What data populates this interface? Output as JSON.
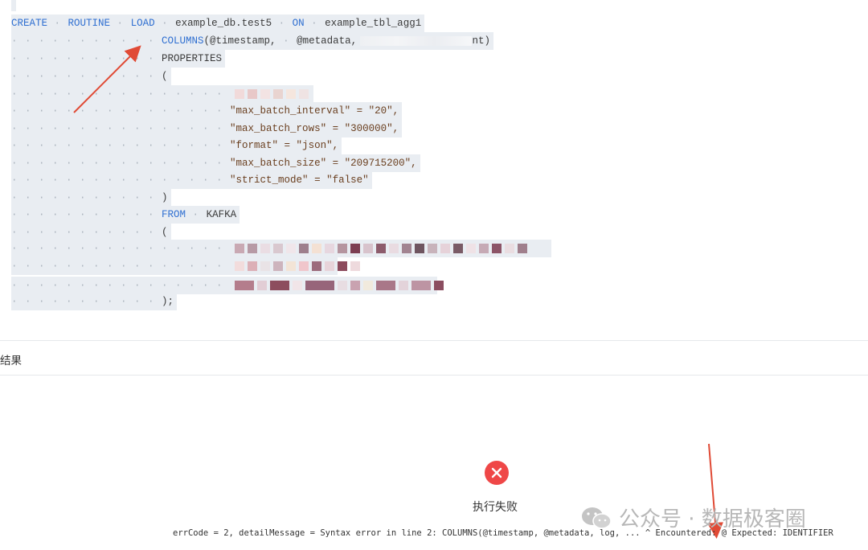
{
  "code": {
    "l1": {
      "kw1": "CREATE",
      "kw2": "ROUTINE",
      "kw3": "LOAD",
      "t1": "example_db.test5",
      "kw4": "ON",
      "t2": "example_tbl_agg1"
    },
    "l2": {
      "kw": "COLUMNS",
      "t1": "(@timestamp,",
      "t2": "@metadata,",
      "t3": "nt)"
    },
    "l3": {
      "kw": "PROPERTIES"
    },
    "l4": {
      "t": "("
    },
    "l6": {
      "t": "\"max_batch_interval\" = \"20\","
    },
    "l7": {
      "t": "\"max_batch_rows\" = \"300000\","
    },
    "l8": {
      "t": "\"format\" = \"json\","
    },
    "l9": {
      "t": "\"max_batch_size\" = \"209715200\","
    },
    "l10": {
      "t": "\"strict_mode\" = \"false\""
    },
    "l11": {
      "t": ")"
    },
    "l12": {
      "kw": "FROM",
      "t": "KAFKA"
    },
    "l13": {
      "t": "("
    },
    "l17": {
      "t": ");"
    }
  },
  "result": {
    "tab_label": "结果",
    "status_title": "执行失败",
    "error_message": "errCode = 2, detailMessage = Syntax error in line 2: COLUMNS(@timestamp, @metadata, log, ... ^ Encountered: @ Expected: IDENTIFIER"
  },
  "watermark": {
    "text": "公众号 · 数据极客圈"
  },
  "colors": {
    "keyword": "#2f6fd1",
    "line_bg": "#e9edf2",
    "error": "#ef4747",
    "arrow": "#e04a35"
  }
}
